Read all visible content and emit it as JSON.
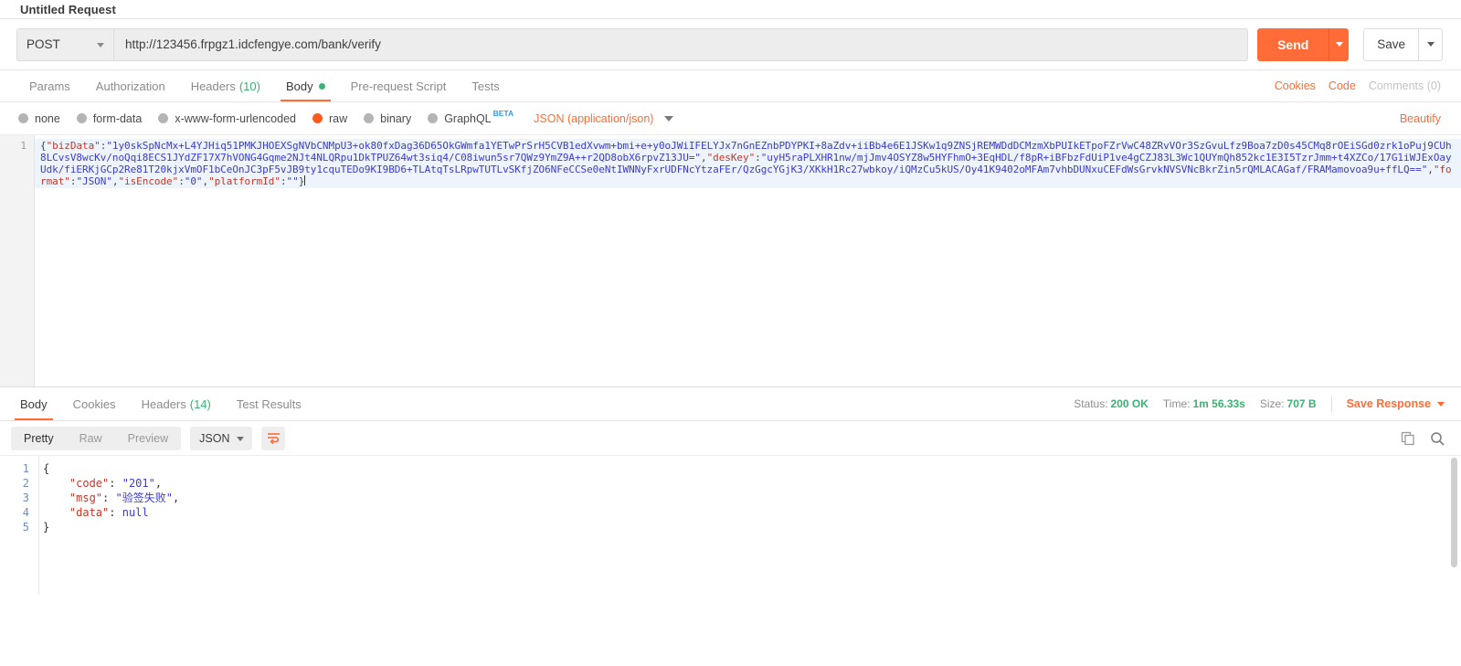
{
  "request": {
    "title": "Untitled Request",
    "method": "POST",
    "url": "http://123456.frpgz1.idcfengye.com/bank/verify",
    "send_label": "Send",
    "save_label": "Save",
    "tabs": [
      {
        "label": "Params",
        "active": false
      },
      {
        "label": "Authorization",
        "active": false
      },
      {
        "label": "Headers",
        "count": "(10)",
        "active": false
      },
      {
        "label": "Body",
        "active": true,
        "dot": true
      },
      {
        "label": "Pre-request Script",
        "active": false
      },
      {
        "label": "Tests",
        "active": false
      }
    ],
    "links": {
      "cookies": "Cookies",
      "code": "Code",
      "comments": "Comments (0)"
    },
    "body_types": [
      {
        "label": "none",
        "selected": false
      },
      {
        "label": "form-data",
        "selected": false
      },
      {
        "label": "x-www-form-urlencoded",
        "selected": false
      },
      {
        "label": "raw",
        "selected": true
      },
      {
        "label": "binary",
        "selected": false
      },
      {
        "label": "GraphQL",
        "selected": false,
        "badge": "BETA"
      }
    ],
    "content_type": "JSON (application/json)",
    "beautify_label": "Beautify",
    "editor": {
      "line_numbers": [
        "1"
      ],
      "raw_body": "{\"bizData\":\"1y0skSpNcMx+L4YJHiq51PMKJHOEXSgNVbCNMpU3+ok80fxDag36D65OkGWmfa1YETwPrSrH5CVB1edXvwm+bmi+e+y0oJWiIFELYJx7nGnEZnbPDYPKI+8aZdv+iiBb4e6E1JSKw1q9ZNSjREMWDdDCMzmXbPUIkETpoFZrVwC48ZRvVOr3SzGvuLfz9Boa7zD0s45CMq8rOEiSGd0zrk1oPuj9CUh8LCvsV8wcKv/noQqi8ECS1JYdZF17X7hVONG4Gqme2NJt4NLQRpu1DkTPUZ64wt3siq4/C08iwun5sr7QWz9YmZ9A++r2QD8obX6rpvZ13JU=\",\"desKey\":\"uyH5raPLXHR1nw/mjJmv4OSYZ8w5HYFhmO+3EqHDL/f8pR+iBFbzFdUiP1ve4gCZJ83L3Wc1QUYmQh852kc1E3I5TzrJmm+t4XZCo/17G1iWJExOayUdk/fiERKjGCp2Re81T20kjxVmOF1bCeOnJC3pF5vJB9ty1cquTEDo9KI9BD6+TLAtqTsLRpwTUTLvSKfjZO6NFeCCSe0eNtIWNNyFxrUDFNcYtzaFEr/QzGgcYGjK3/XKkH1Rc27wbkoy/iQMzCu5kUS/Oy41K9402oMFAm7vhbDUNxuCEFdWsGrvkNVSVNcBkrZin5rQMLACAGaf/FRAMamovoa9u+ffLQ==\",\"format\":\"JSON\",\"isEncode\":\"0\",\"platformId\":\"\"}"
    }
  },
  "response": {
    "tabs": [
      {
        "label": "Body",
        "active": true
      },
      {
        "label": "Cookies",
        "active": false
      },
      {
        "label": "Headers",
        "count": "(14)",
        "active": false
      },
      {
        "label": "Test Results",
        "active": false
      }
    ],
    "meta": {
      "status_label": "Status:",
      "status_value": "200 OK",
      "time_label": "Time:",
      "time_value": "1m 56.33s",
      "size_label": "Size:",
      "size_value": "707 B",
      "save_response": "Save Response"
    },
    "view_modes": [
      {
        "label": "Pretty",
        "active": true
      },
      {
        "label": "Raw",
        "active": false
      },
      {
        "label": "Preview",
        "active": false
      }
    ],
    "format": "JSON",
    "line_numbers": [
      "1",
      "2",
      "3",
      "4",
      "5"
    ],
    "json_lines": [
      {
        "indent": 0,
        "open": "{"
      },
      {
        "indent": 1,
        "key": "\"code\"",
        "colon": ": ",
        "value": "\"201\"",
        "type": "string",
        "comma": ","
      },
      {
        "indent": 1,
        "key": "\"msg\"",
        "colon": ": ",
        "value": "\"验签失败\"",
        "type": "string",
        "comma": ","
      },
      {
        "indent": 1,
        "key": "\"data\"",
        "colon": ": ",
        "value": "null",
        "type": "null",
        "comma": ""
      },
      {
        "indent": 0,
        "close": "}"
      }
    ]
  },
  "colors": {
    "accent": "#ff6c37",
    "success": "#3bb273",
    "beta": "#3a9ae0",
    "string": "#3c3cc8",
    "key": "#c0392b"
  }
}
